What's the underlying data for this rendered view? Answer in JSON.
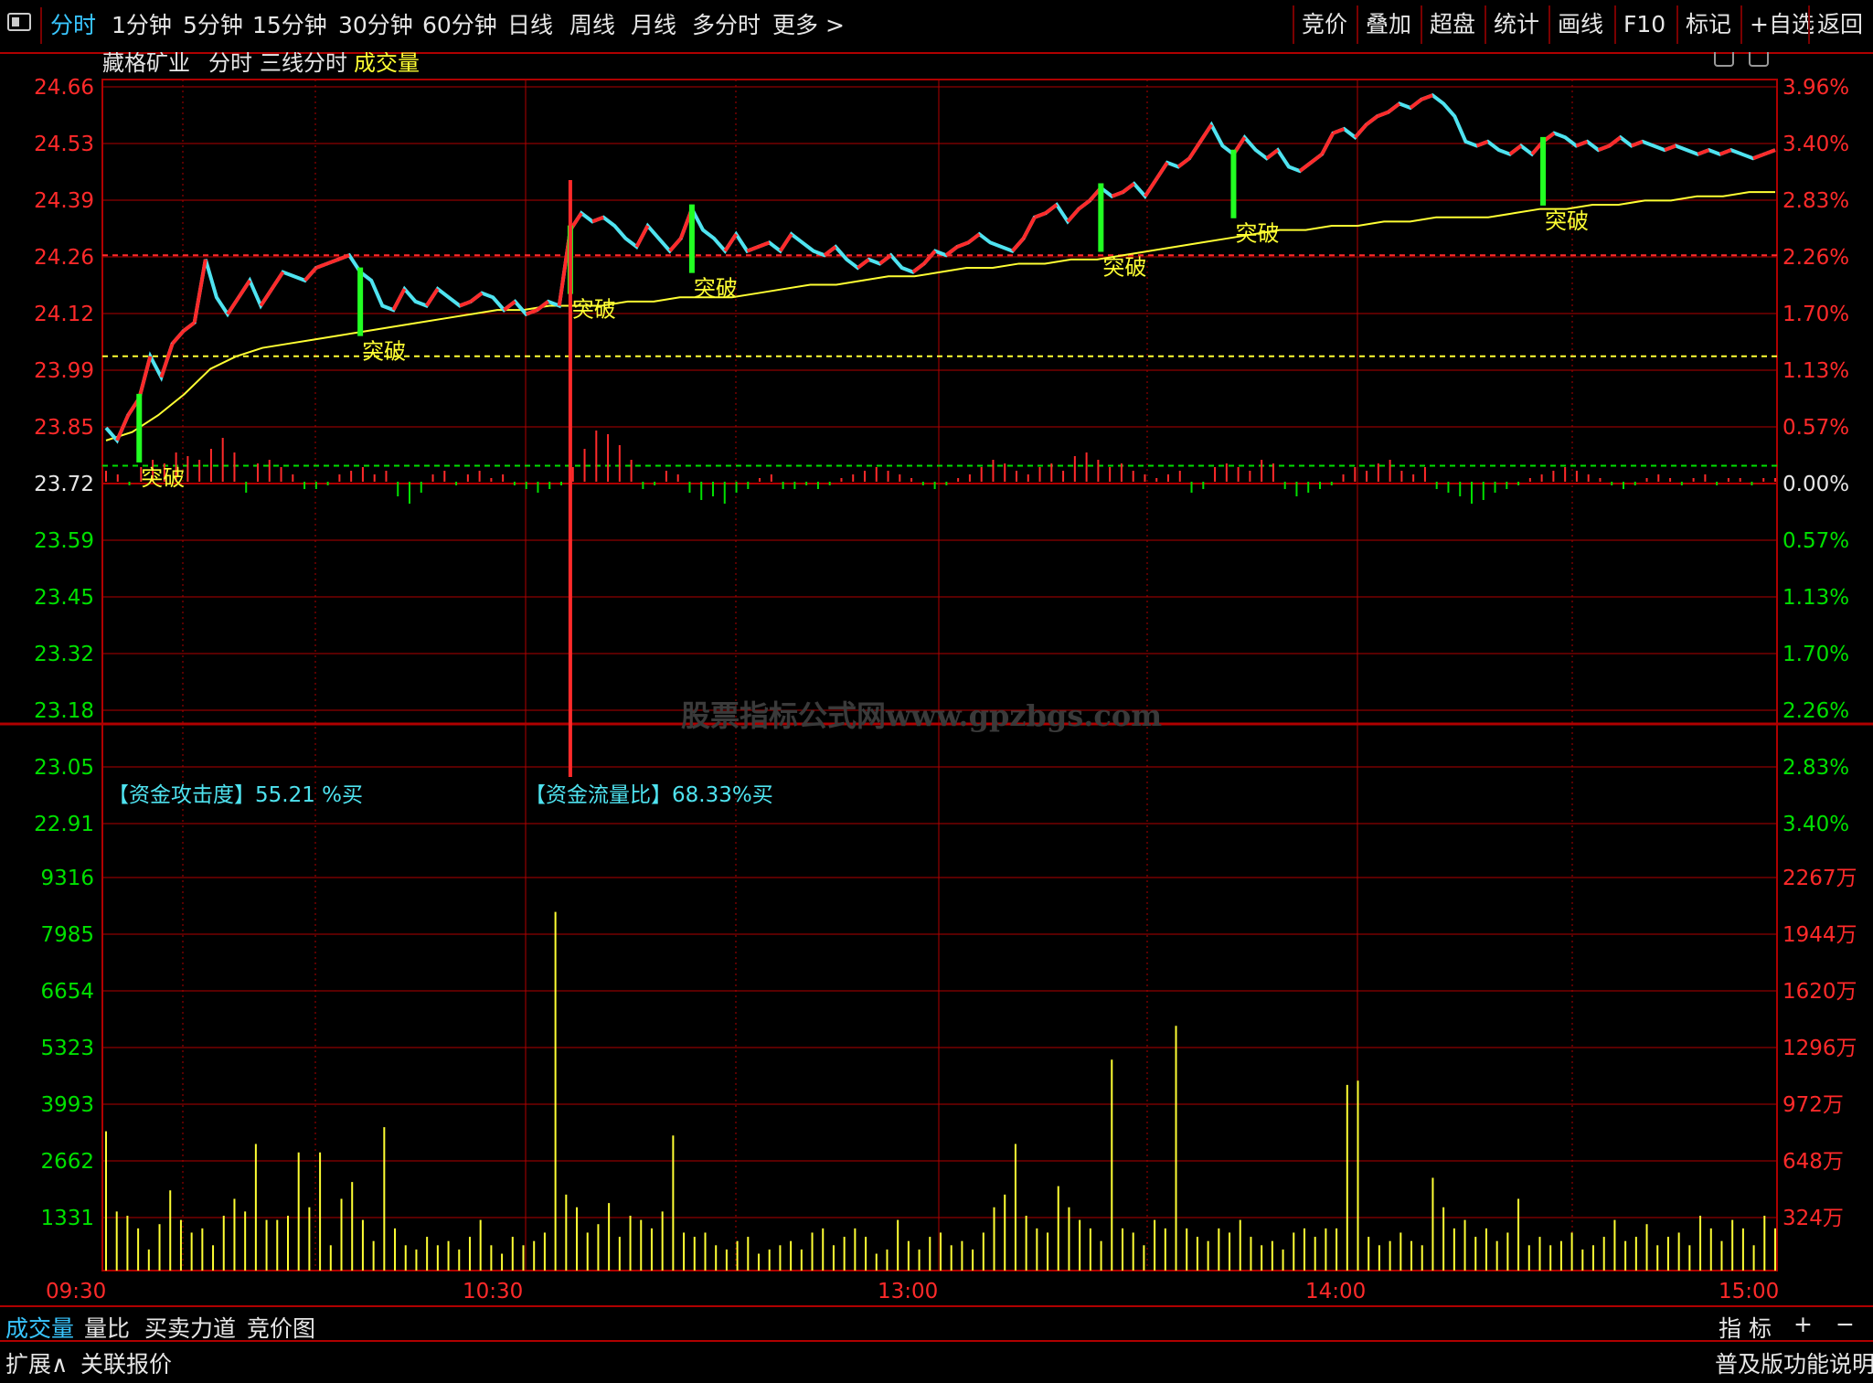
{
  "toolbar": {
    "periods": [
      {
        "label": "分时",
        "active": true
      },
      {
        "label": "1分钟"
      },
      {
        "label": "5分钟"
      },
      {
        "label": "15分钟"
      },
      {
        "label": "30分钟"
      },
      {
        "label": "60分钟"
      },
      {
        "label": "日线"
      },
      {
        "label": "周线"
      },
      {
        "label": "月线"
      },
      {
        "label": "多分时"
      },
      {
        "label": "更多 >"
      }
    ],
    "actions": [
      "竞价",
      "叠加",
      "超盘",
      "统计",
      "画线",
      "F10",
      "标记",
      "+自选",
      "返回"
    ]
  },
  "header": {
    "stock": "藏格矿业",
    "mode": "分时",
    "indicator": "三线分时",
    "volume_label": "成交量"
  },
  "watermark": "股票指标公式网www.gpzbgs.com",
  "colors": {
    "up": "#ff2a2a",
    "down": "#00e000",
    "cyan": "#4fe3f0",
    "yellow": "#ffff33",
    "grid": "#b00000",
    "bg": "#000000"
  },
  "bottom": {
    "tabs": [
      "成交量",
      "量比",
      "买卖力道",
      "竞价图"
    ],
    "right": [
      "指 标",
      "+",
      "−"
    ],
    "row2_left": [
      "扩展∧",
      "关联报价"
    ],
    "row2_right": "普及版功能说明"
  },
  "chart_data": [
    {
      "type": "line",
      "title": "",
      "base_price": 23.72,
      "y_ticks_left": [
        "24.66",
        "24.53",
        "24.39",
        "24.26",
        "24.12",
        "23.99",
        "23.85",
        "23.72",
        "23.59",
        "23.45",
        "23.32",
        "23.18",
        "23.05",
        "22.91"
      ],
      "y_ticks_right": [
        "3.96%",
        "3.40%",
        "2.83%",
        "2.26%",
        "1.70%",
        "1.13%",
        "0.57%",
        "0.00%",
        "0.57%",
        "1.13%",
        "1.70%",
        "2.26%",
        "2.83%",
        "3.40%"
      ],
      "ylim": [
        22.91,
        24.66
      ],
      "series": [],
      "price": [
        23.85,
        23.82,
        23.88,
        23.92,
        24.02,
        23.97,
        24.05,
        24.08,
        24.1,
        24.25,
        24.16,
        24.12,
        24.16,
        24.2,
        24.14,
        24.18,
        24.22,
        24.21,
        24.2,
        24.23,
        24.24,
        24.25,
        24.26,
        24.22,
        24.2,
        24.14,
        24.13,
        24.18,
        24.15,
        24.14,
        24.18,
        24.16,
        24.14,
        24.15,
        24.17,
        24.16,
        24.13,
        24.15,
        24.12,
        24.13,
        24.15,
        24.14,
        24.32,
        24.36,
        24.34,
        24.35,
        24.33,
        24.3,
        24.28,
        24.33,
        24.3,
        24.27,
        24.3,
        24.37,
        24.32,
        24.3,
        24.27,
        24.31,
        24.27,
        24.28,
        24.29,
        24.27,
        24.31,
        24.29,
        24.27,
        24.26,
        24.28,
        24.25,
        24.23,
        24.25,
        24.24,
        24.26,
        24.23,
        24.22,
        24.24,
        24.27,
        24.26,
        24.28,
        24.29,
        24.31,
        24.29,
        24.28,
        24.27,
        24.3,
        24.35,
        24.36,
        24.38,
        24.34,
        24.37,
        24.39,
        24.42,
        24.4,
        24.41,
        24.43,
        24.4,
        24.44,
        24.48,
        24.47,
        24.49,
        24.53,
        24.57,
        24.52,
        24.5,
        24.54,
        24.51,
        24.49,
        24.51,
        24.47,
        24.46,
        24.48,
        24.5,
        24.55,
        24.56,
        24.54,
        24.57,
        24.59,
        24.6,
        24.62,
        24.61,
        24.63,
        24.64,
        24.62,
        24.59,
        24.53,
        24.52,
        24.53,
        24.51,
        24.5,
        24.52,
        24.5,
        24.53,
        24.55,
        24.54,
        24.52,
        24.53,
        24.51,
        24.52,
        24.54,
        24.52,
        24.53,
        24.52,
        24.51,
        24.52,
        24.51,
        24.5,
        24.51,
        24.5,
        24.51,
        24.5,
        24.49,
        24.5,
        24.51
      ],
      "avg": [
        23.82,
        23.84,
        23.88,
        23.93,
        23.99,
        24.02,
        24.04,
        24.05,
        24.06,
        24.07,
        24.08,
        24.09,
        24.1,
        24.11,
        24.12,
        24.13,
        24.13,
        24.14,
        24.14,
        24.14,
        24.15,
        24.15,
        24.16,
        24.16,
        24.16,
        24.17,
        24.18,
        24.19,
        24.19,
        24.2,
        24.21,
        24.21,
        24.22,
        24.23,
        24.23,
        24.24,
        24.24,
        24.25,
        24.25,
        24.26,
        24.27,
        24.28,
        24.29,
        24.3,
        24.31,
        24.32,
        24.32,
        24.33,
        24.33,
        24.34,
        24.34,
        24.35,
        24.35,
        24.35,
        24.36,
        24.37,
        24.37,
        24.38,
        24.38,
        24.39,
        24.39,
        24.4,
        24.4,
        24.41,
        24.41
      ],
      "dashed_levels": [
        24.26,
        24.02,
        23.76
      ],
      "annotations": [
        {
          "text": "突破",
          "t": 3
        },
        {
          "text": "突破",
          "t": 23
        },
        {
          "text": "突破",
          "t": 42
        },
        {
          "text": "突破",
          "t": 53
        },
        {
          "text": "突破",
          "t": 90
        },
        {
          "text": "突破",
          "t": 102
        },
        {
          "text": "突破",
          "t": 130
        }
      ],
      "net_flow": [
        3,
        2,
        -1,
        4,
        6,
        5,
        8,
        7,
        6,
        9,
        12,
        8,
        -3,
        5,
        6,
        4,
        2,
        -2,
        -2,
        -1,
        2,
        3,
        4,
        2,
        3,
        -4,
        -6,
        -3,
        2,
        3,
        -1,
        2,
        3,
        1,
        2,
        -1,
        -2,
        -3,
        -2,
        -1,
        4,
        9,
        14,
        13,
        10,
        6,
        -2,
        -1,
        3,
        2,
        -3,
        -5,
        -4,
        -6,
        -3,
        -2,
        1,
        2,
        -2,
        -2,
        -1,
        -2,
        -1,
        1,
        2,
        3,
        4,
        3,
        2,
        1,
        -1,
        -2,
        -1,
        1,
        2,
        4,
        6,
        5,
        3,
        2,
        4,
        5,
        3,
        7,
        8,
        6,
        4,
        5,
        3,
        2,
        1,
        2,
        3,
        -3,
        -2,
        4,
        5,
        4,
        3,
        6,
        5,
        -2,
        -4,
        -3,
        -2,
        -1,
        2,
        4,
        3,
        5,
        6,
        3,
        2,
        4,
        -2,
        -3,
        -4,
        -6,
        -5,
        -3,
        -2,
        -1,
        1,
        2,
        3,
        4,
        3,
        2,
        1,
        -1,
        -2,
        -1,
        1,
        2,
        1,
        -1,
        1,
        2,
        -1,
        1,
        1,
        -1,
        1,
        1
      ],
      "labels": [
        {
          "text": "【资金攻击度】55.21 %买"
        },
        {
          "text": "【资金流量比】68.33%买"
        }
      ]
    },
    {
      "type": "bar",
      "title": "",
      "y_ticks_left": [
        "9316",
        "7985",
        "6654",
        "5323",
        "3993",
        "2662",
        "1331"
      ],
      "y_ticks_right": [
        "2267万",
        "1944万",
        "1620万",
        "1296万",
        "972万",
        "648万",
        "324万"
      ],
      "ylim": [
        0,
        9316
      ],
      "x_labels": [
        "09:30",
        "10:30",
        "13:00",
        "14:00",
        "15:00"
      ],
      "values": [
        3300,
        1400,
        1300,
        1000,
        500,
        1100,
        1900,
        1200,
        900,
        1000,
        600,
        1300,
        1700,
        1400,
        3000,
        1200,
        1200,
        1300,
        2800,
        1500,
        2800,
        600,
        1700,
        2100,
        1200,
        700,
        3400,
        1000,
        600,
        500,
        800,
        600,
        700,
        500,
        800,
        1200,
        600,
        400,
        800,
        600,
        700,
        900,
        8500,
        1800,
        1500,
        900,
        1100,
        1600,
        800,
        1300,
        1200,
        1000,
        1400,
        3200,
        900,
        800,
        900,
        600,
        500,
        700,
        800,
        400,
        500,
        600,
        700,
        500,
        900,
        1000,
        600,
        800,
        1000,
        800,
        400,
        500,
        1200,
        700,
        500,
        800,
        900,
        600,
        700,
        500,
        900,
        1500,
        1800,
        3000,
        1300,
        1000,
        900,
        2000,
        1500,
        1200,
        1000,
        700,
        5000,
        1000,
        900,
        600,
        1200,
        1000,
        5800,
        1000,
        800,
        700,
        1000,
        900,
        1200,
        800,
        600,
        700,
        500,
        900,
        1000,
        800,
        1000,
        1000,
        4400,
        4500,
        800,
        600,
        700,
        900,
        700,
        600,
        2200,
        1500,
        1000,
        1200,
        800,
        1000,
        700,
        900,
        1700,
        600,
        800,
        600,
        700,
        900,
        500,
        600,
        800,
        1200,
        700,
        800,
        1100,
        600,
        800,
        900,
        600,
        1300,
        1000,
        700,
        1200,
        1000,
        600,
        1300,
        1000
      ],
      "xlabel": "",
      "ylabel": ""
    }
  ]
}
